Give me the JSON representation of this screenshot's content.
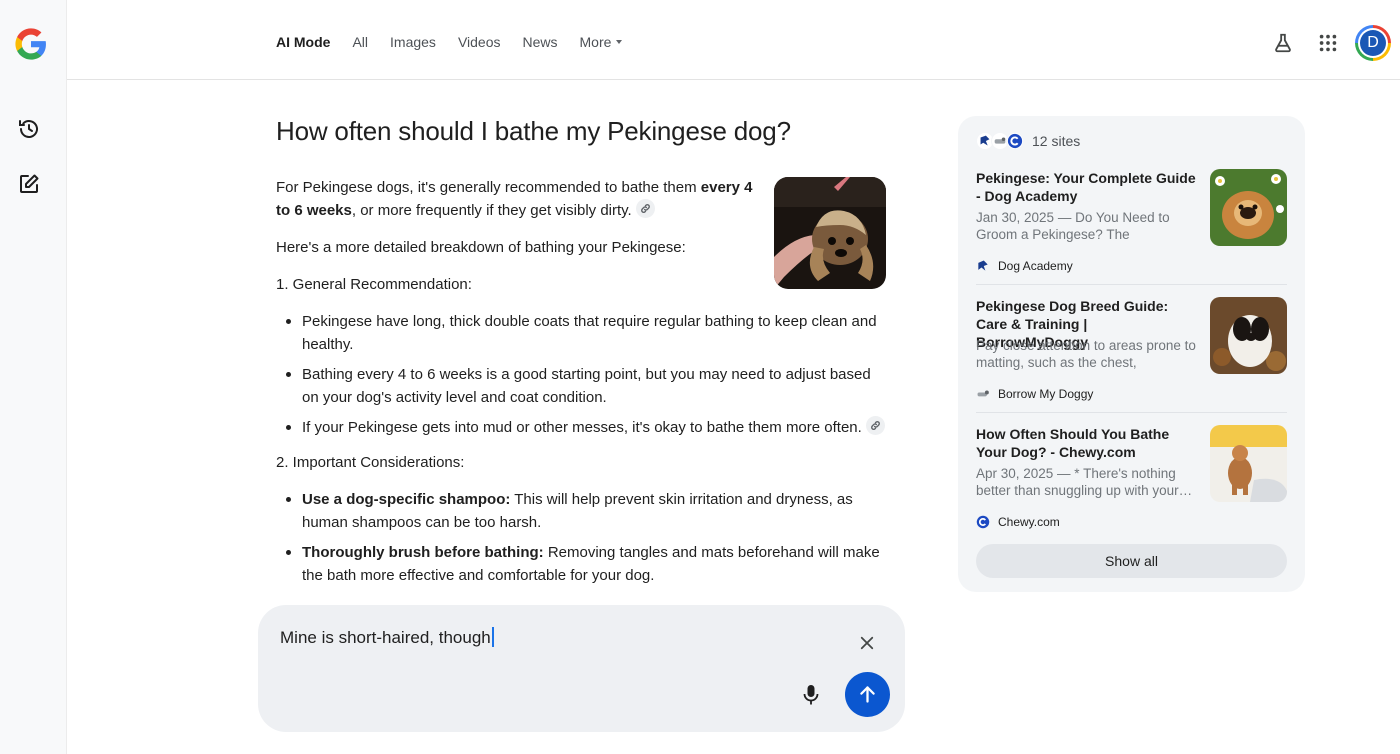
{
  "nav": {
    "tabs": [
      {
        "label": "AI Mode",
        "active": true
      },
      {
        "label": "All"
      },
      {
        "label": "Images"
      },
      {
        "label": "Videos"
      },
      {
        "label": "News"
      },
      {
        "label": "More"
      }
    ],
    "avatar_letter": "D"
  },
  "main": {
    "question": "How often should I bathe my Pekingese dog?",
    "intro_a": "For Pekingese dogs, it's generally recommended to bathe them ",
    "intro_bold": "every 4 to 6 weeks",
    "intro_b": ", or more frequently if they get visibly dirty.",
    "breakdown": "Here's a more detailed breakdown of bathing your Pekingese:",
    "section1_title": "1. General Recommendation:",
    "section1_items": [
      "Pekingese have long, thick double coats that require regular bathing to keep clean and healthy.",
      "Bathing every 4 to 6 weeks is a good starting point, but you may need to adjust based on your dog's activity level and coat condition.",
      "If your Pekingese gets into mud or other messes, it's okay to bathe them more often."
    ],
    "section2_title": "2. Important Considerations:",
    "section2_items": [
      {
        "bold": "Use a dog-specific shampoo:",
        "text": " This will help prevent skin irritation and dryness, as human shampoos can be too harsh."
      },
      {
        "bold": "Thoroughly brush before bathing:",
        "text": " Removing tangles and mats beforehand will make the bath more effective and comfortable for your dog."
      }
    ]
  },
  "sources": {
    "count_label": "12 sites",
    "items": [
      {
        "title": "Pekingese: Your Complete Guide - Dog Academy",
        "snippet": "Jan 30, 2025 — Do You Need to Groom a Pekingese? The Pekingese…",
        "site": "Dog Academy"
      },
      {
        "title": "Pekingese Dog Breed Guide: Care & Training | BorrowMyDoggy",
        "snippet": "Pay close attention to areas prone to matting, such as the chest, armpits,…",
        "site": "Borrow My Doggy"
      },
      {
        "title": "How Often Should You Bathe Your Dog? - Chewy.com",
        "snippet": "Apr 30, 2025 — * There's nothing better than snuggling up with your…",
        "site": "Chewy.com"
      }
    ],
    "show_all_label": "Show all"
  },
  "input": {
    "value": "Mine is short-haired, though"
  },
  "colors": {
    "accent": "#0b57d0",
    "panel": "#f3f5f7"
  }
}
